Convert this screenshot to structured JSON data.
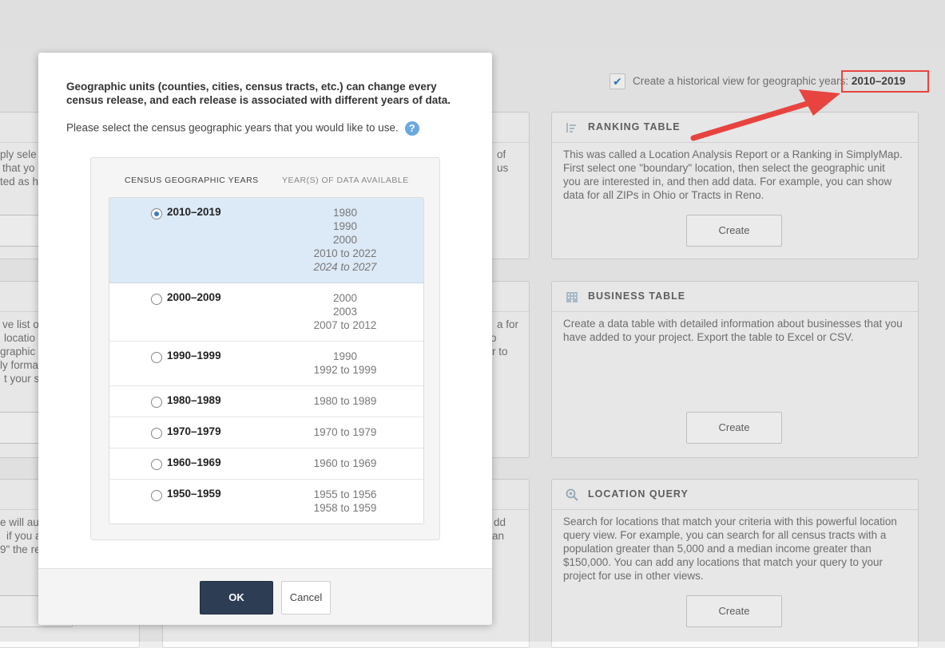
{
  "background": {
    "history": {
      "label": "Create a historical view for geographic years: ",
      "years": "2010–2019",
      "checked": true
    },
    "cards": [
      {
        "title": "RANKING TABLE",
        "icon": "list-icon",
        "description": "This was called a Location Analysis Report or a Ranking in SimplyMap. First select one \"boundary\" location, then select the geographic unit you are interested in, and then add data. For example, you can show data for all ZIPs in Ohio or Tracts in Reno.",
        "button": "Create"
      },
      {
        "title": "BUSINESS TABLE",
        "icon": "building-icon",
        "description": "Create a data table with detailed information about businesses that you have added to your project. Export the table to Excel or CSV.",
        "button": "Create"
      },
      {
        "title": "LOCATION QUERY",
        "icon": "search-icon",
        "description": "Search for locations that match your criteria with this powerful location query view. For example, you can search for all census tracts with a population greater than 5,000 and a median income greater than $150,000. You can add any locations that match your query to your project for use in other views.",
        "button": "Create"
      }
    ],
    "snippets": [
      "ply sele",
      "that yo",
      "ted as h",
      "ve list o",
      "locatio",
      "graphic",
      "ly forma",
      "t your s",
      "e will au",
      "if you a",
      "9\" the re",
      "of",
      "us",
      "a for",
      "o",
      "r to",
      "dd",
      "an"
    ]
  },
  "modal": {
    "intro": "Geographic units (counties, cities, census tracts, etc.) can change every census release, and each release is associated with different years of data.",
    "prompt": "Please select the census geographic years that you would like to use.",
    "help": "?",
    "col1": "CENSUS GEOGRAPHIC YEARS",
    "col2": "YEAR(S) OF DATA AVAILABLE",
    "rows": [
      {
        "label": "2010–2019",
        "years": [
          "1980",
          "1990",
          "2000",
          "2010 to 2022"
        ],
        "projected": "2024 to 2027",
        "selected": true
      },
      {
        "label": "2000–2009",
        "years": [
          "2000",
          "2003",
          "2007 to 2012"
        ],
        "selected": false
      },
      {
        "label": "1990–1999",
        "years": [
          "1990",
          "1992 to 1999"
        ],
        "selected": false
      },
      {
        "label": "1980–1989",
        "years": [
          "1980 to 1989"
        ],
        "selected": false
      },
      {
        "label": "1970–1979",
        "years": [
          "1970 to 1979"
        ],
        "selected": false
      },
      {
        "label": "1960–1969",
        "years": [
          "1960 to 1969"
        ],
        "selected": false
      },
      {
        "label": "1950–1959",
        "years": [
          "1955 to 1956",
          "1958 to 1959"
        ],
        "selected": false
      }
    ],
    "ok": "OK",
    "cancel": "Cancel"
  },
  "colors": {
    "accent": "#2d3d54",
    "selected_row": "#dce9f6",
    "highlight": "#e8443f",
    "radio": "#3b78c8"
  }
}
